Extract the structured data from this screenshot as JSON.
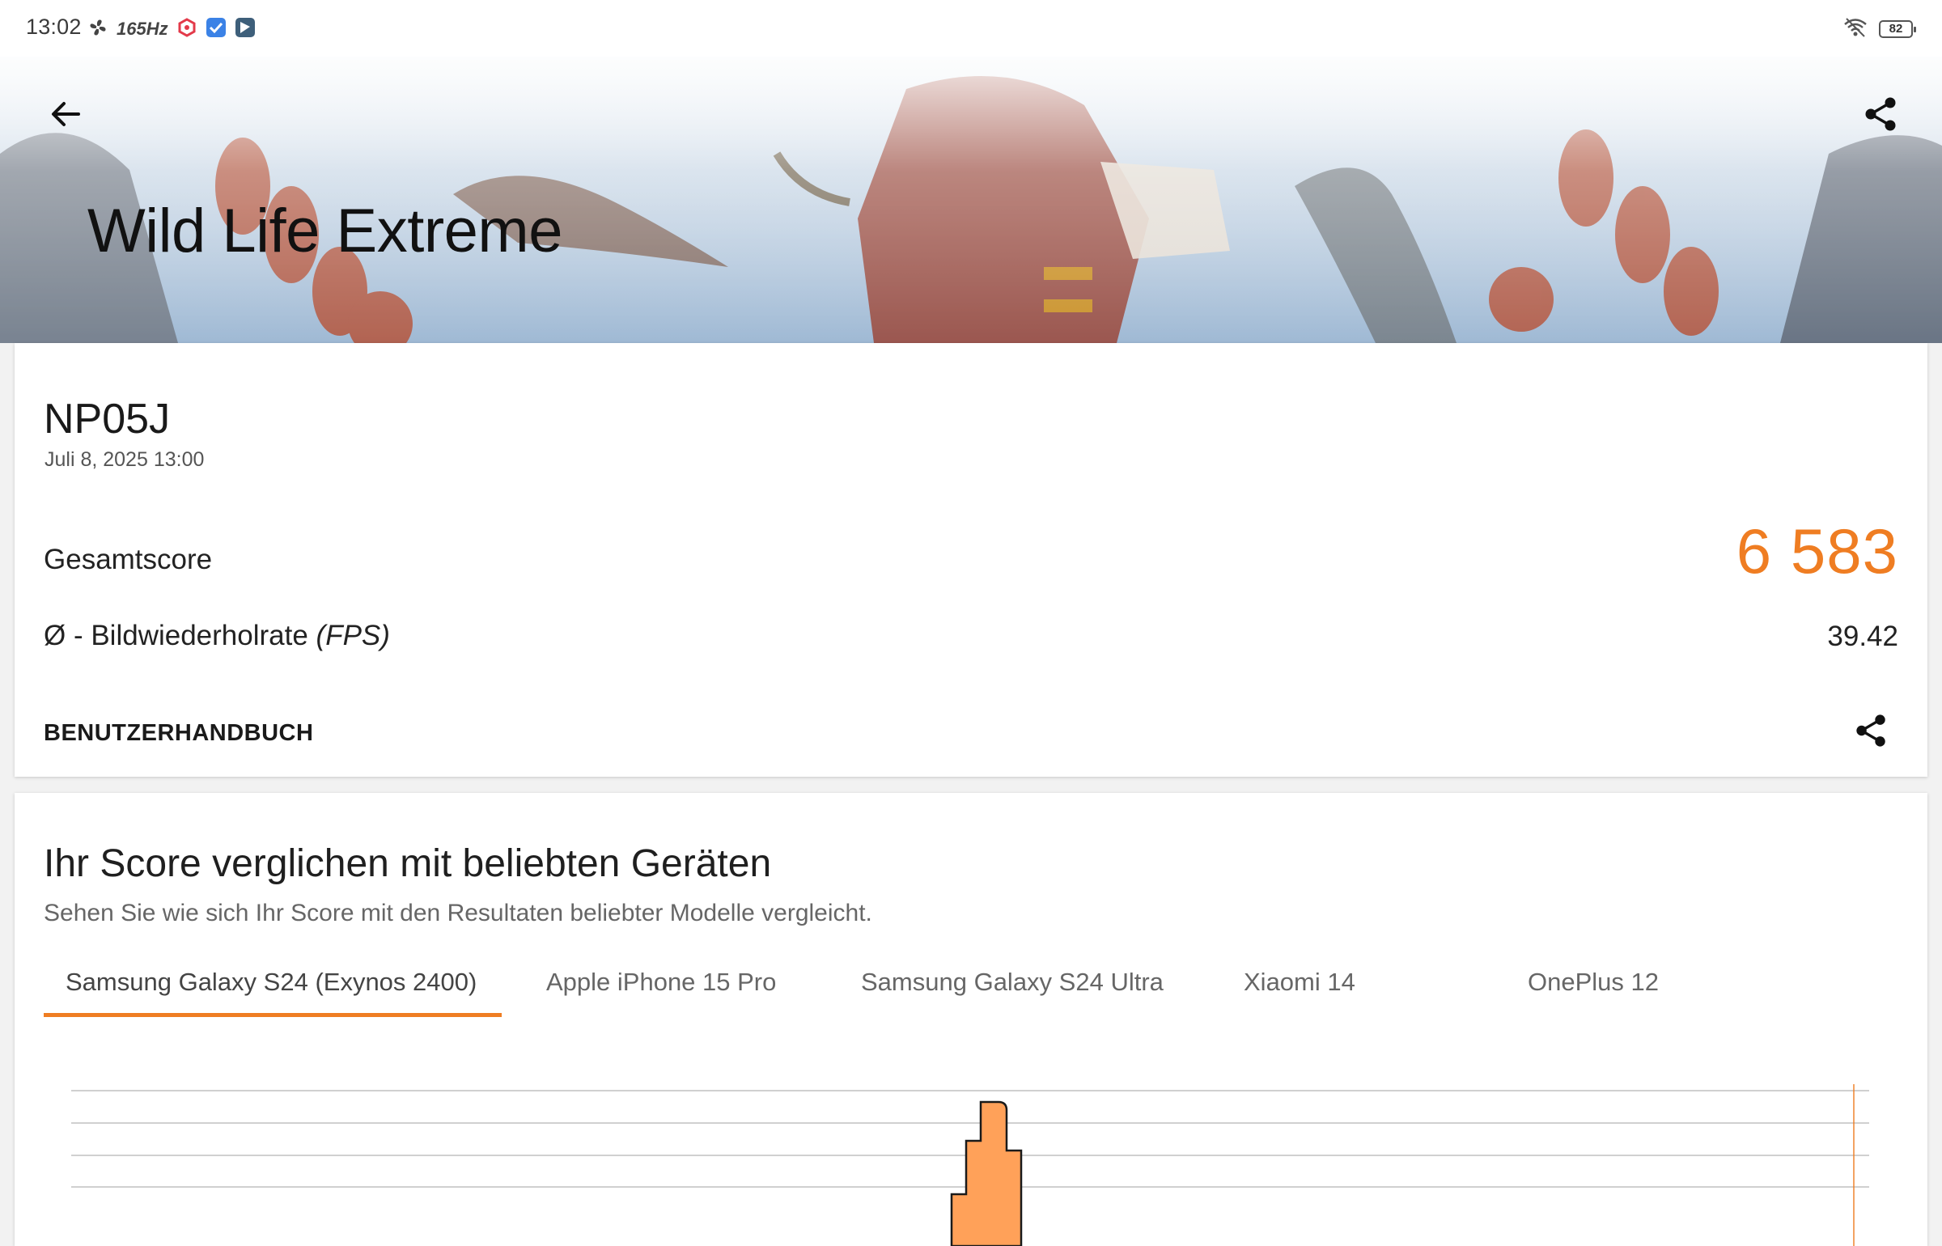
{
  "status_bar": {
    "time": "13:02",
    "refresh_rate": "165Hz",
    "battery": "82",
    "icons_left": [
      "fan-icon",
      "hz-icon",
      "app-red-icon",
      "app-check-icon",
      "app-flag-icon"
    ],
    "icons_right": [
      "wifi-icon",
      "battery-icon"
    ]
  },
  "header": {
    "title": "Wild Life Extreme",
    "back_icon": "arrow-left-icon",
    "share_icon": "share-icon"
  },
  "result": {
    "device_name": "NP05J",
    "date": "Juli 8, 2025 13:00",
    "score_label": "Gesamtscore",
    "score_value": "6 583",
    "fps_label_prefix": "Ø - Bildwiederholrate ",
    "fps_label_unit": "(FPS)",
    "fps_value": "39.42",
    "manual_label": "BENUTZERHANDBUCH",
    "accent_color": "#ef7d22"
  },
  "compare": {
    "title": "Ihr Score verglichen mit beliebten Geräten",
    "subtitle": "Sehen Sie wie sich Ihr Score mit den Resultaten beliebter Modelle vergleicht.",
    "tabs": [
      {
        "label": "Samsung Galaxy S24 (Exynos 2400)",
        "active": true
      },
      {
        "label": "Apple iPhone 15 Pro",
        "active": false
      },
      {
        "label": "Samsung Galaxy S24 Ultra",
        "active": false
      },
      {
        "label": "Xiaomi 14",
        "active": false
      },
      {
        "label": "OnePlus 12",
        "active": false
      }
    ]
  }
}
